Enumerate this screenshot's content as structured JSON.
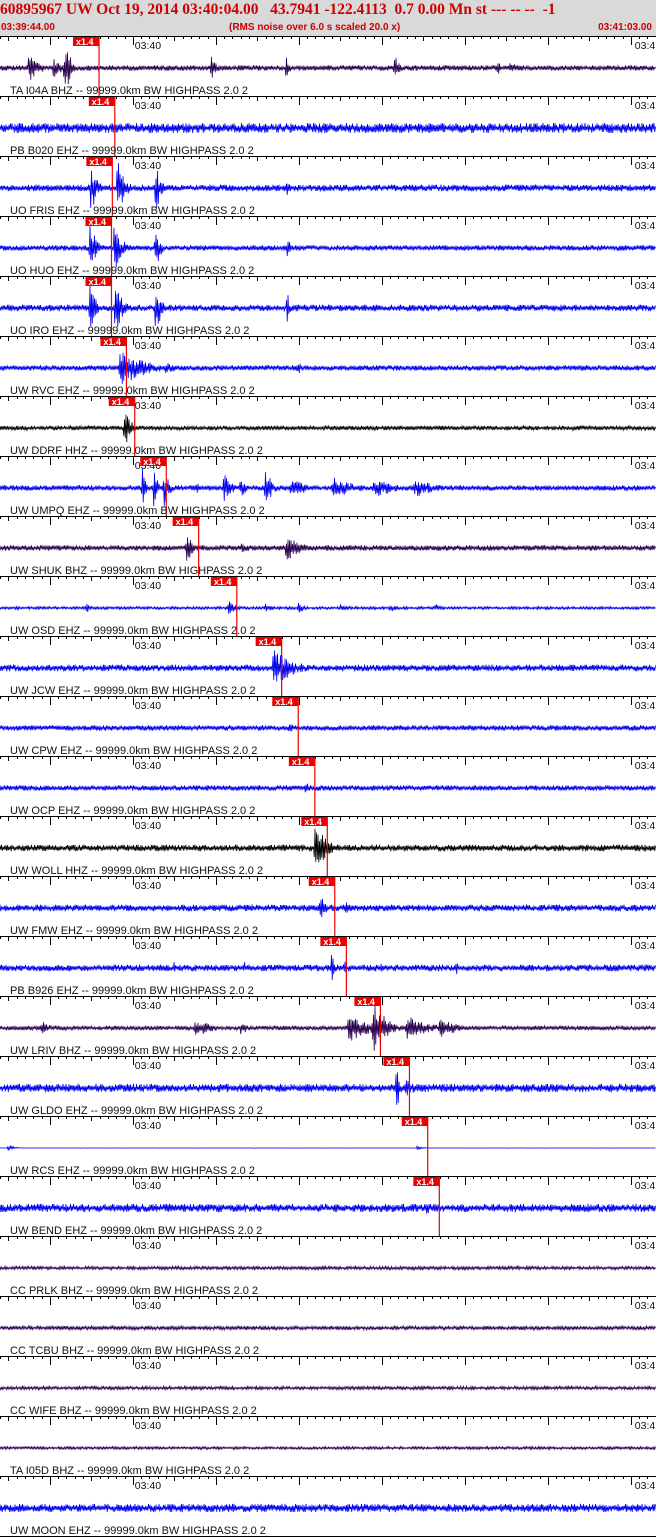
{
  "header": {
    "title": "60895967 UW Oct 19, 2014 03:40:04.00   43.7941 -122.4113  0.7 0.00 Mn st --- -- --  -1",
    "start_time": "03:39:44.00",
    "note": "(RMS noise over 6.0 s scaled 20.0 x)",
    "end_time": "03:41:03.00"
  },
  "colors": {
    "header_bg": "#d9d9d9",
    "header_text": "#cc0000",
    "pick": "#ee0000",
    "broadband_trace": "#2a0050",
    "short_period_trace": "#0000ee",
    "hh_trace": "#000000"
  },
  "chart_data": {
    "type": "line",
    "title": "60895967 UW Oct 19, 2014 03:40:04.00   43.7941 -122.4113  0.7 0.00 Mn st --- -- --  -1",
    "x_range": [
      "03:39:44.00",
      "03:41:03.00"
    ],
    "x_ticks": [
      {
        "label": "03:40",
        "t": 16
      },
      {
        "label": "03:4",
        "t": 76
      }
    ],
    "pick_label": "x1.4",
    "traces": [
      {
        "label": "TA I04A BHZ -- 99999.0km BW  HIGHPASS  2.0  2",
        "kind": "bb",
        "pick_t": 8.8,
        "amp": 0.1,
        "events": [
          [
            3.5,
            0.55,
            1.2
          ],
          [
            6.5,
            0.45,
            0.8
          ],
          [
            7.8,
            0.85,
            0.6
          ],
          [
            8.2,
            0.8,
            0.4
          ],
          [
            25.5,
            0.55,
            0.5
          ],
          [
            34.5,
            0.45,
            0.4
          ],
          [
            47.5,
            0.6,
            0.5
          ],
          [
            60,
            0.25,
            0.5
          ],
          [
            61.5,
            0.2,
            0.4
          ],
          [
            61.8,
            0.25,
            0.3
          ]
        ]
      },
      {
        "label": "PB B020 EHZ -- 99999.0km BW  HIGHPASS  2.0  2",
        "kind": "sp",
        "pick_t": 10.7,
        "amp": 0.18,
        "events": [
          [
            50,
            0.22,
            2.0
          ]
        ]
      },
      {
        "label": "UO FRIS EHZ -- 99999.0km BW  HIGHPASS  2.0  2",
        "kind": "sp",
        "pick_t": 10.4,
        "amp": 0.12,
        "events": [
          [
            11.0,
            1.0,
            0.7
          ],
          [
            14.2,
            1.0,
            0.8
          ],
          [
            18.8,
            1.0,
            0.5
          ],
          [
            34.6,
            0.6,
            0.2
          ]
        ]
      },
      {
        "label": "UO HUO EHZ -- 99999.0km BW  HIGHPASS  2.0  2",
        "kind": "sp",
        "pick_t": 10.3,
        "amp": 0.1,
        "events": [
          [
            10.9,
            1.0,
            0.6
          ],
          [
            13.8,
            1.0,
            0.8
          ],
          [
            18.7,
            1.0,
            0.5
          ],
          [
            34.7,
            0.7,
            0.2
          ]
        ]
      },
      {
        "label": "UO IRO EHZ -- 99999.0km BW  HIGHPASS  2.0  2",
        "kind": "sp",
        "pick_t": 10.3,
        "amp": 0.12,
        "events": [
          [
            10.9,
            1.0,
            0.6
          ],
          [
            13.9,
            1.0,
            0.8
          ],
          [
            18.8,
            1.0,
            0.6
          ],
          [
            34.6,
            1.0,
            0.2
          ]
        ]
      },
      {
        "label": "UW RVC EHZ -- 99999.0km BW  HIGHPASS  2.0  2",
        "kind": "sp",
        "pick_t": 12.1,
        "amp": 0.1,
        "events": [
          [
            14.5,
            0.7,
            2.8
          ],
          [
            20,
            0.2,
            2.0
          ],
          [
            30,
            0.1,
            3.0
          ],
          [
            36,
            0.25,
            0.3
          ]
        ]
      },
      {
        "label": "UW DDRF HHZ -- 99999.0km BW  HIGHPASS  2.0  2",
        "kind": "hh",
        "pick_t": 13.1,
        "amp": 0.08,
        "events": [
          [
            15.0,
            0.8,
            0.7
          ]
        ]
      },
      {
        "label": "UW UMPQ EHZ -- 99999.0km BW  HIGHPASS  2.0  2",
        "kind": "sp",
        "pick_t": 16.9,
        "amp": 0.1,
        "events": [
          [
            17.2,
            1.0,
            0.3
          ],
          [
            18.6,
            1.0,
            0.3
          ],
          [
            19.8,
            0.7,
            0.6
          ],
          [
            23.8,
            0.25,
            0.3
          ],
          [
            27,
            0.6,
            0.8
          ],
          [
            29,
            0.4,
            0.6
          ],
          [
            32,
            0.7,
            0.8
          ],
          [
            35,
            0.4,
            2.0
          ],
          [
            40,
            0.45,
            2.5
          ],
          [
            45,
            0.4,
            2.5
          ],
          [
            50,
            0.35,
            2.5
          ]
        ]
      },
      {
        "label": "UW SHUK BHZ -- 99999.0km BW  HIGHPASS  2.0  2",
        "kind": "bb",
        "pick_t": 20.8,
        "amp": 0.1,
        "events": [
          [
            22.5,
            0.55,
            0.8
          ],
          [
            29,
            0.2,
            2.0
          ],
          [
            34.5,
            0.6,
            1.5
          ]
        ]
      },
      {
        "label": "UW OSD EHZ -- 99999.0km BW  HIGHPASS  2.0  2",
        "kind": "sp",
        "pick_t": 25.4,
        "amp": 0.05,
        "events": [
          [
            10.5,
            0.25,
            0.2
          ],
          [
            27.5,
            0.3,
            1.0
          ],
          [
            32,
            0.15,
            1.0
          ],
          [
            36,
            0.2,
            0.8
          ],
          [
            41,
            0.15,
            1.2
          ],
          [
            47,
            0.15,
            1.0
          ],
          [
            52.5,
            0.15,
            1.0
          ]
        ]
      },
      {
        "label": "UW JCW EHZ -- 99999.0km BW  HIGHPASS  2.0  2",
        "kind": "sp",
        "pick_t": 30.8,
        "amp": 0.12,
        "events": [
          [
            33.0,
            0.85,
            2.0
          ]
        ]
      },
      {
        "label": "UW CPW EHZ -- 99999.0km BW  HIGHPASS  2.0  2",
        "kind": "sp",
        "pick_t": 32.8,
        "amp": 0.1,
        "events": [
          [
            34.8,
            0.2,
            1.0
          ]
        ]
      },
      {
        "label": "UW OCP EHZ -- 99999.0km BW  HIGHPASS  2.0  2",
        "kind": "sp",
        "pick_t": 34.8,
        "amp": 0.1,
        "events": [
          [
            36.8,
            0.2,
            1.0
          ]
        ]
      },
      {
        "label": "UW WOLL HHZ -- 99999.0km BW  HIGHPASS  2.0  2",
        "kind": "hh",
        "pick_t": 36.3,
        "amp": 0.12,
        "events": [
          [
            38.0,
            1.0,
            1.2
          ]
        ]
      },
      {
        "label": "UW FMW EHZ -- 99999.0km BW  HIGHPASS  2.0  2",
        "kind": "sp",
        "pick_t": 37.2,
        "amp": 0.12,
        "events": [
          [
            38.6,
            0.5,
            0.8
          ],
          [
            41.6,
            0.3,
            0.5
          ]
        ]
      },
      {
        "label": "PB B926 EHZ -- 99999.0km BW  HIGHPASS  2.0  2",
        "kind": "sp",
        "pick_t": 38.6,
        "amp": 0.12,
        "events": [
          [
            21,
            0.3,
            0.2
          ],
          [
            29.5,
            0.3,
            0.2
          ],
          [
            40,
            1.0,
            0.2
          ],
          [
            41.5,
            0.3,
            0.3
          ],
          [
            46,
            0.3,
            0.2
          ],
          [
            55,
            0.3,
            0.2
          ]
        ]
      },
      {
        "label": "UW LRIV BHZ -- 99999.0km BW  HIGHPASS  2.0  2",
        "kind": "bb",
        "pick_t": 42.7,
        "amp": 0.08,
        "events": [
          [
            5,
            0.3,
            1.0
          ],
          [
            23.5,
            0.35,
            2.0
          ],
          [
            29,
            0.25,
            1.0
          ],
          [
            42,
            0.55,
            2.5
          ],
          [
            45,
            1.0,
            1.5
          ],
          [
            49,
            0.5,
            2.5
          ],
          [
            53,
            0.4,
            2.0
          ]
        ]
      },
      {
        "label": "UW GLDO EHZ -- 99999.0km BW  HIGHPASS  2.0  2",
        "kind": "sp",
        "pick_t": 46.2,
        "amp": 0.15,
        "events": [
          [
            47.8,
            1.0,
            0.3
          ],
          [
            48.8,
            0.3,
            2.0
          ]
        ]
      },
      {
        "label": "UW RCS EHZ -- 99999.0km BW  HIGHPASS  2.0  2",
        "kind": "sp",
        "pick_t": 48.4,
        "amp": 0.005,
        "events": [
          [
            1.0,
            0.12,
            0.6
          ],
          [
            50.3,
            0.08,
            0.5
          ]
        ]
      },
      {
        "label": "UW BEND EHZ -- 99999.0km BW  HIGHPASS  2.0  2",
        "kind": "sp",
        "pick_t": 49.8,
        "amp": 0.15,
        "events": [
          [
            51.5,
            0.3,
            0.6
          ]
        ]
      },
      {
        "label": "CC PRLK BHZ -- 99999.0km BW  HIGHPASS  2.0  2",
        "kind": "bb",
        "pick_t": null,
        "amp": 0.06,
        "events": []
      },
      {
        "label": "CC TCBU BHZ -- 99999.0km BW  HIGHPASS  2.0  2",
        "kind": "bb",
        "pick_t": null,
        "amp": 0.07,
        "events": []
      },
      {
        "label": "CC WIFE BHZ -- 99999.0km BW  HIGHPASS  2.0  2",
        "kind": "bb",
        "pick_t": null,
        "amp": 0.06,
        "events": []
      },
      {
        "label": "TA I05D BHZ -- 99999.0km BW  HIGHPASS  2.0  2",
        "kind": "bb",
        "pick_t": null,
        "amp": 0.05,
        "events": []
      },
      {
        "label": "UW MOON EHZ -- 99999.0km BW  HIGHPASS  2.0  2",
        "kind": "sp",
        "pick_t": null,
        "amp": 0.15,
        "events": []
      }
    ]
  }
}
